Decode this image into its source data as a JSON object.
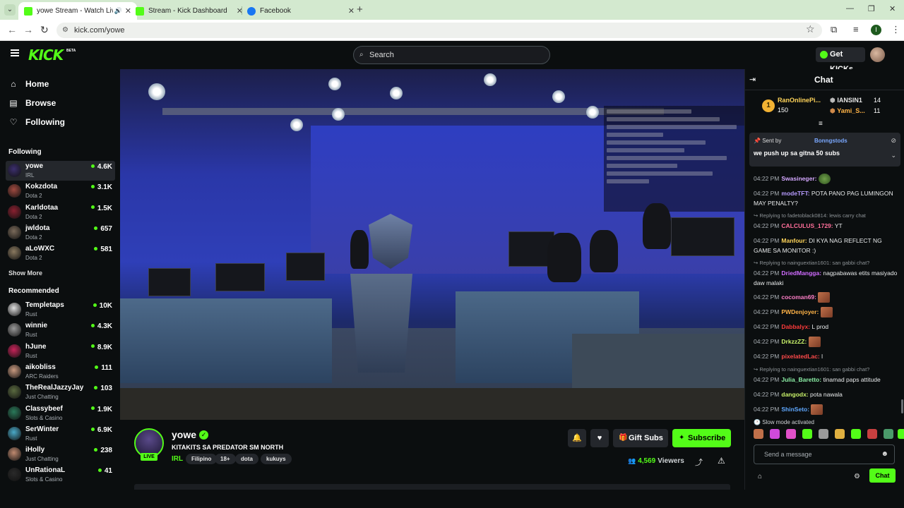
{
  "browser": {
    "tabs": [
      {
        "title": "yowe Stream - Watch Live o",
        "active": true,
        "favicon_color": "#53fc18",
        "has_audio_icon": true
      },
      {
        "title": "Stream - Kick Dashboard",
        "active": false,
        "favicon_color": "#53fc18"
      },
      {
        "title": "Facebook",
        "active": false,
        "favicon_color": "#1877f2"
      }
    ],
    "url": "kick.com/yowe",
    "profile_initial": "I"
  },
  "header": {
    "logo": "KICK",
    "beta": "BETA",
    "search_placeholder": "Search",
    "get_kicks_label": "Get KICKs"
  },
  "sidebar": {
    "nav": [
      {
        "icon": "home-icon",
        "glyph": "⌂",
        "label": "Home"
      },
      {
        "icon": "browse-icon",
        "glyph": "▤",
        "label": "Browse"
      },
      {
        "icon": "heart-icon",
        "glyph": "♡",
        "label": "Following"
      }
    ],
    "following_title": "Following",
    "following": [
      {
        "name": "yowe",
        "category": "IRL",
        "viewers": "4.6K",
        "selected": true,
        "avatar_color": "#3c2f6e"
      },
      {
        "name": "Kokzdota",
        "category": "Dota 2",
        "viewers": "3.1K",
        "avatar_color": "#a04a40"
      },
      {
        "name": "Karldotaa",
        "category": "Dota 2",
        "viewers": "1.5K",
        "avatar_color": "#8a2030"
      },
      {
        "name": "jwldota",
        "category": "Dota 2",
        "viewers": "657",
        "avatar_color": "#7a6a5a"
      },
      {
        "name": "aLoWXC",
        "category": "Dota 2",
        "viewers": "581",
        "avatar_color": "#8a7a60"
      }
    ],
    "show_more": "Show More",
    "recommended_title": "Recommended",
    "recommended": [
      {
        "name": "Templetaps",
        "category": "Rust",
        "viewers": "10K",
        "avatar_color": "#e0e0e0"
      },
      {
        "name": "winnie",
        "category": "Rust",
        "viewers": "4.3K",
        "avatar_color": "#9a9a9a"
      },
      {
        "name": "hJune",
        "category": "Rust",
        "viewers": "8.9K",
        "avatar_color": "#c8245a"
      },
      {
        "name": "aikobliss",
        "category": "ARC Raiders",
        "viewers": "111",
        "avatar_color": "#c89a80"
      },
      {
        "name": "TheRealJazzyJay",
        "category": "Just Chatting",
        "viewers": "103",
        "avatar_color": "#5a6a40"
      },
      {
        "name": "Classybeef",
        "category": "Slots & Casino",
        "viewers": "1.9K",
        "avatar_color": "#2a7a5a"
      },
      {
        "name": "SerWinter",
        "category": "Rust",
        "viewers": "6.9K",
        "avatar_color": "#4aaac8"
      },
      {
        "name": "iHolly",
        "category": "Just Chatting",
        "viewers": "238",
        "avatar_color": "#c08a70"
      },
      {
        "name": "UnRationaL",
        "category": "Slots & Casino",
        "viewers": "41",
        "avatar_color": "#2a2a2a"
      }
    ]
  },
  "stream": {
    "channel": "yowe",
    "live_label": "LIVE",
    "title": "KITAKITS SA PREDATOR SM NORTH",
    "category": "IRL",
    "tags": [
      "Filipino",
      "18+",
      "dota",
      "kukuys"
    ],
    "gift_subs_label": "Gift Subs",
    "subscribe_label": "Subscribe",
    "viewers_count": "4,569",
    "viewers_label": "Viewers"
  },
  "chat": {
    "title": "Chat",
    "leaderboard": [
      {
        "rank": "1",
        "name": "RanOnlinePi...",
        "value": "150"
      },
      {
        "name": "IANSIN1",
        "value": "14"
      },
      {
        "name": "Yami_S...",
        "value": "11"
      }
    ],
    "pinned": {
      "sent_by": "Sent by",
      "sender": "Bonngstods",
      "message": "we push up sa gitna 50 subs"
    },
    "messages": [
      {
        "time": "04:22 PM",
        "user": "Swasineger:",
        "text": "",
        "color": "#d4a8ff",
        "emote": "pepe"
      },
      {
        "time": "04:22 PM",
        "user": "modeTFT:",
        "text": " POTA PANO PAG LUMINGON MAY PENALTY?",
        "color": "#b79bff"
      },
      {
        "reply": "Replying to fadetoblack0814: lewis carry chat",
        "time": "04:22 PM",
        "user": "CALCULUS_1729:",
        "text": " YT",
        "color": "#ff6f9a"
      },
      {
        "time": "04:22 PM",
        "user": "Manfour:",
        "text": " DI KYA NAG REFLECT NG GAME SA MONITOR :)",
        "color": "#ffd45a"
      },
      {
        "reply": "Replying to nainguextian1601: san gabbi chat?",
        "time": "04:22 PM",
        "user": "DriedMangga:",
        "text": " nagpabawas etits masiyado daw malaki",
        "color": "#d06cff"
      },
      {
        "time": "04:22 PM",
        "user": "cocoman69:",
        "text": "",
        "color": "#ff7fc8",
        "emote": "face"
      },
      {
        "time": "04:22 PM",
        "user": "PWDenjoyer:",
        "text": "",
        "color": "#ffb347",
        "emote": "face"
      },
      {
        "time": "04:22 PM",
        "user": "Dabbalyx:",
        "text": " L prod",
        "color": "#ff3b3b"
      },
      {
        "time": "04:22 PM",
        "user": "DrkzzZZ:",
        "text": "",
        "color": "#c9f26a",
        "emote": "face"
      },
      {
        "time": "04:22 PM",
        "user": "pixelatedLac:",
        "text": " l",
        "color": "#ff4a4a"
      },
      {
        "reply": "Replying to nainguextian1601: san gabbi chat?",
        "time": "04:22 PM",
        "user": "Julia_Baretto:",
        "text": " tinamad paps attitude",
        "color": "#8cf0a6"
      },
      {
        "time": "04:22 PM",
        "user": "dangodx:",
        "text": " pota nawala",
        "color": "#c9f26a"
      },
      {
        "time": "04:22 PM",
        "user": "ShinSeto:",
        "text": "",
        "color": "#5fa8ff",
        "emote": "face"
      }
    ],
    "slow_mode": "Slow mode activated",
    "send_placeholder": "Send a message",
    "chat_button": "Chat"
  }
}
